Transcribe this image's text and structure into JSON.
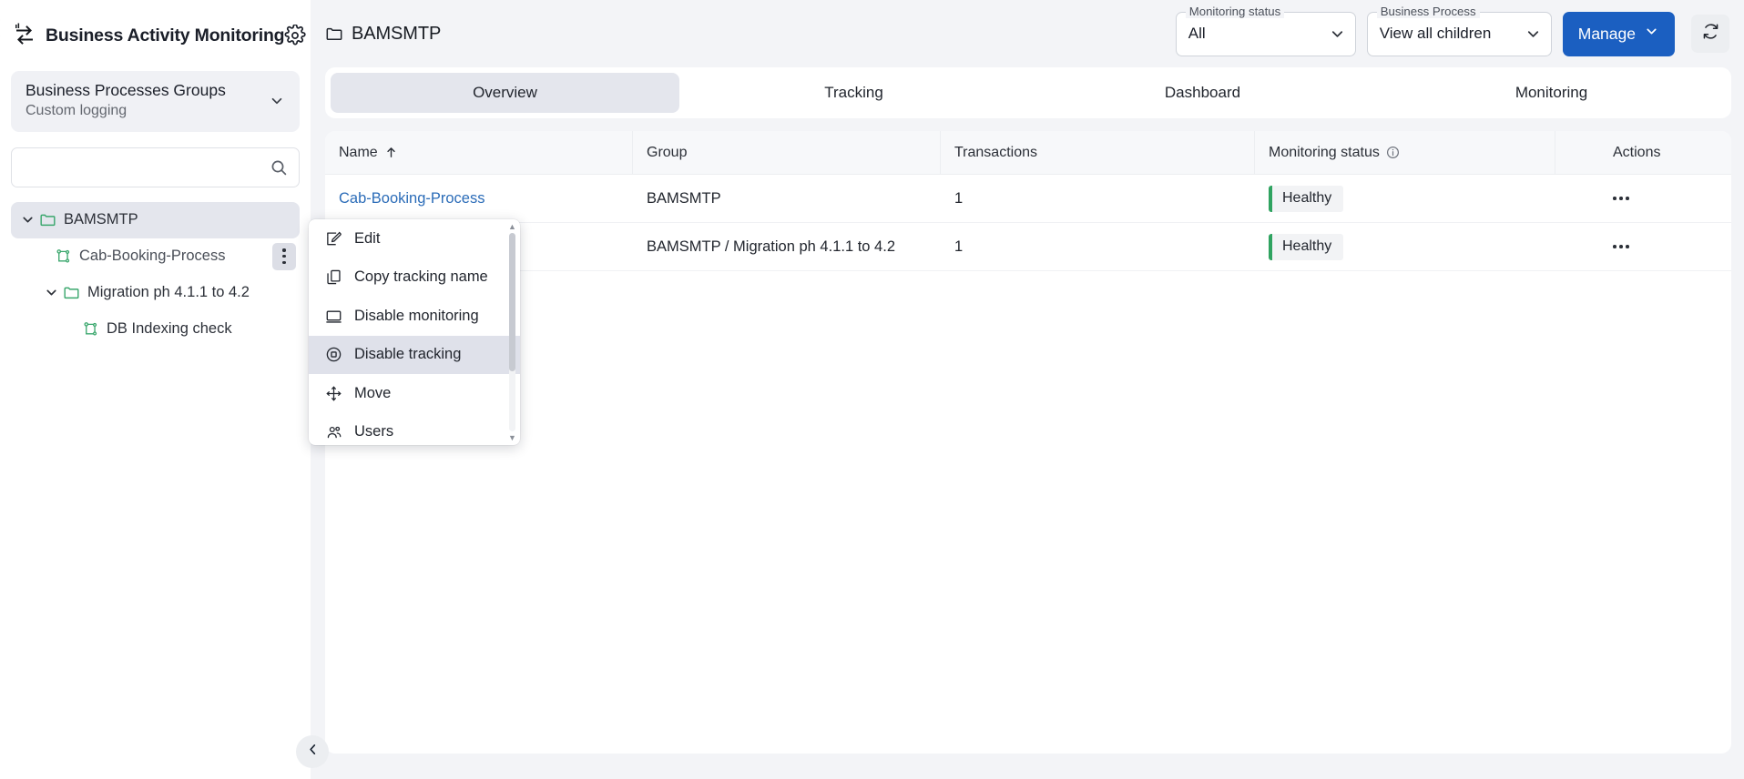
{
  "sidebar": {
    "brand_logo_icon": "bam-exchange-arrows-logo",
    "brand_title": "Business Activity Monitoring",
    "settings_icon": "gear-icon",
    "group_card": {
      "title": "Business Processes Groups",
      "subtitle": "Custom logging",
      "chevron_icon": "chevron-down-icon"
    },
    "search": {
      "value": "",
      "placeholder": "",
      "icon": "search-icon"
    },
    "tree": [
      {
        "label": "BAMSMTP",
        "icon": "folder-icon",
        "chevron": "chevron-down-icon",
        "indent": 0,
        "selected": true,
        "kebab": true,
        "type": "folder"
      },
      {
        "label": "Cab-Booking-Process",
        "icon": "process-flow-icon",
        "chevron": "",
        "indent": 1,
        "selected": false,
        "kebab": true,
        "type": "process"
      },
      {
        "label": "Migration ph 4.1.1 to 4.2",
        "icon": "folder-icon",
        "chevron": "chevron-down-icon",
        "indent": 1,
        "selected": false,
        "kebab": false,
        "type": "folder"
      },
      {
        "label": "DB Indexing check",
        "icon": "process-flow-icon",
        "chevron": "",
        "indent": 2,
        "selected": false,
        "kebab": false,
        "type": "process"
      }
    ],
    "collapse_icon": "chevron-left-icon"
  },
  "header": {
    "breadcrumb_icon": "folder-icon",
    "breadcrumb_title": "BAMSMTP",
    "filters": [
      {
        "legend": "Monitoring status",
        "value": "All",
        "chevron_icon": "chevron-down-icon"
      },
      {
        "legend": "Business Process",
        "value": "View all children",
        "chevron_icon": "chevron-down-icon"
      }
    ],
    "manage_label": "Manage",
    "manage_chevron_icon": "chevron-down-icon",
    "refresh_icon": "refresh-icon"
  },
  "tabs": [
    {
      "label": "Overview",
      "active": true
    },
    {
      "label": "Tracking",
      "active": false
    },
    {
      "label": "Dashboard",
      "active": false
    },
    {
      "label": "Monitoring",
      "active": false
    }
  ],
  "table": {
    "columns": [
      {
        "label": "Name",
        "sort_icon": "arrow-up-icon",
        "info_icon": ""
      },
      {
        "label": "Group",
        "sort_icon": "",
        "info_icon": ""
      },
      {
        "label": "Transactions",
        "sort_icon": "",
        "info_icon": ""
      },
      {
        "label": "Monitoring status",
        "sort_icon": "",
        "info_icon": "info-circle-icon"
      },
      {
        "label": "Actions",
        "sort_icon": "",
        "info_icon": ""
      }
    ],
    "rows": [
      {
        "name": "Cab-Booking-Process",
        "group": "BAMSMTP",
        "transactions": "1",
        "status": "Healthy",
        "status_color": "#2fa360",
        "actions_icon": "more-horizontal-icon"
      },
      {
        "name": "",
        "group": "BAMSMTP / Migration ph 4.1.1 to 4.2",
        "transactions": "1",
        "status": "Healthy",
        "status_color": "#2fa360",
        "actions_icon": "more-horizontal-icon"
      }
    ]
  },
  "context_menu": {
    "items": [
      {
        "label": "Edit",
        "icon": "edit-pencil-icon",
        "active": false
      },
      {
        "label": "Copy tracking name",
        "icon": "copy-icon",
        "active": false
      },
      {
        "label": "Disable monitoring",
        "icon": "monitor-icon",
        "active": false
      },
      {
        "label": "Disable tracking",
        "icon": "target-circle-icon",
        "active": true
      },
      {
        "label": "Move",
        "icon": "move-arrows-icon",
        "active": false
      },
      {
        "label": "Users",
        "icon": "users-icon",
        "active": false
      }
    ],
    "scroll_up_icon": "caret-up-icon",
    "scroll_down_icon": "caret-down-icon"
  },
  "colors": {
    "accent": "#1b5fc1",
    "healthy": "#2fa360",
    "link": "#2b6cb8",
    "surface": "#f3f4f7"
  }
}
